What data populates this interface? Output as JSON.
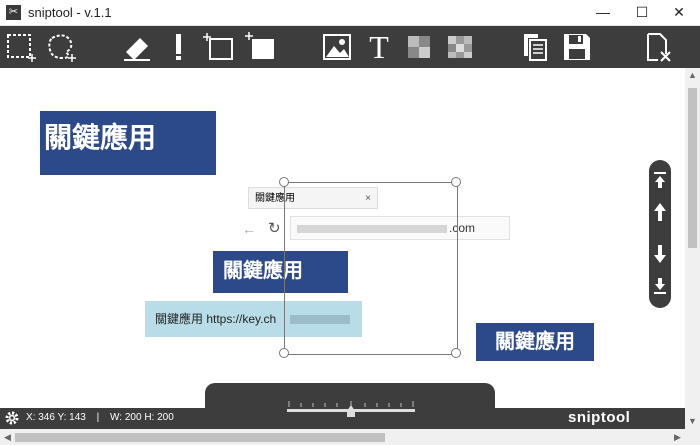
{
  "window": {
    "title": "sniptool - v.1.1",
    "minimize": "—",
    "maximize": "☐",
    "close": "✕"
  },
  "toolbar": {
    "tools": [
      {
        "name": "rect-select-icon"
      },
      {
        "name": "free-select-icon"
      },
      {
        "name": "eraser-icon"
      },
      {
        "name": "marker-icon"
      },
      {
        "name": "add-rect-outline-icon"
      },
      {
        "name": "add-rect-filled-icon"
      },
      {
        "name": "image-icon"
      },
      {
        "name": "text-icon"
      },
      {
        "name": "blur-small-icon"
      },
      {
        "name": "blur-large-icon"
      },
      {
        "name": "copy-icon"
      },
      {
        "name": "save-icon"
      },
      {
        "name": "close-doc-icon"
      }
    ],
    "text_tool_glyph": "T"
  },
  "canvas": {
    "label_primary": "關鍵應用",
    "label_browser": "關鍵應用",
    "label_right": "關鍵應用",
    "browser_tab_text": "關鍵應用",
    "browser_tab_close": "×",
    "browser_url": ".com",
    "tooltip_text": "關鍵應用 https://key.ch"
  },
  "status": {
    "coords": "X: 346 Y: 143",
    "size": "W: 200 H: 200",
    "brand": "sniptool"
  },
  "zoom": {
    "level": 0.5
  },
  "colors": {
    "toolbar_bg": "#3d3d3d",
    "label_blue": "#2c4a8a",
    "tooltip_bg": "#b9dde8"
  }
}
